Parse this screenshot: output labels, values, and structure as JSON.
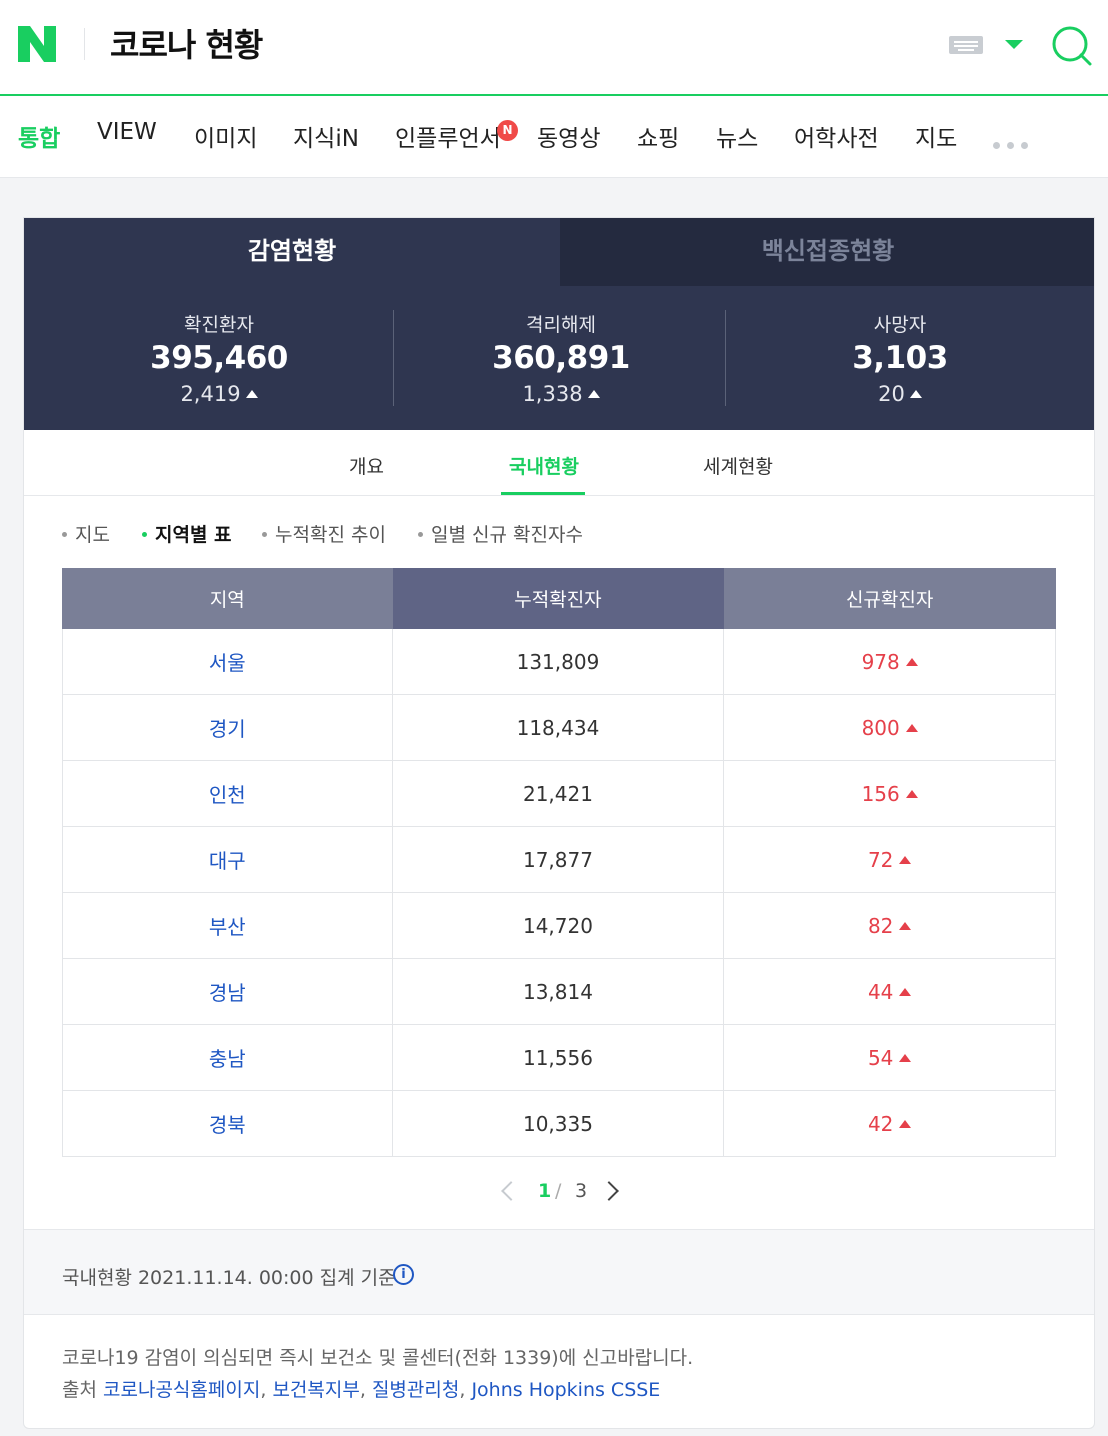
{
  "header": {
    "query": "코로나 현황"
  },
  "tabs": [
    "통합",
    "VIEW",
    "이미지",
    "지식iN",
    "인플루언서",
    "동영상",
    "쇼핑",
    "뉴스",
    "어학사전",
    "지도"
  ],
  "influencer_badge": "N",
  "card_tabs": [
    "감염현황",
    "백신접종현황"
  ],
  "stats": [
    {
      "label": "확진환자",
      "value": "395,460",
      "change": "2,419"
    },
    {
      "label": "격리해제",
      "value": "360,891",
      "change": "1,338"
    },
    {
      "label": "사망자",
      "value": "3,103",
      "change": "20"
    }
  ],
  "subtabs": [
    "개요",
    "국내현황",
    "세계현황"
  ],
  "filters": [
    "지도",
    "지역별 표",
    "누적확진 추이",
    "일별 신규 확진자수"
  ],
  "table": {
    "headers": [
      "지역",
      "누적확진자",
      "신규확진자"
    ],
    "rows": [
      {
        "region": "서울",
        "total": "131,809",
        "new": "978"
      },
      {
        "region": "경기",
        "total": "118,434",
        "new": "800"
      },
      {
        "region": "인천",
        "total": "21,421",
        "new": "156"
      },
      {
        "region": "대구",
        "total": "17,877",
        "new": "72"
      },
      {
        "region": "부산",
        "total": "14,720",
        "new": "82"
      },
      {
        "region": "경남",
        "total": "13,814",
        "new": "44"
      },
      {
        "region": "충남",
        "total": "11,556",
        "new": "54"
      },
      {
        "region": "경북",
        "total": "10,335",
        "new": "42"
      }
    ]
  },
  "pager": {
    "current": "1",
    "sep": "/",
    "total": "3"
  },
  "footer": {
    "basis": "국내현황 2021.11.14. 00:00 집계 기준",
    "notice": "코로나19 감염이 의심되면 즉시 보건소 및 콜센터(전화 1339)에 신고바랍니다.",
    "source_label": "출처",
    "sources": [
      "코로나공식홈페이지",
      "보건복지부",
      "질병관리청",
      "Johns Hopkins CSSE"
    ]
  },
  "colors": {
    "brand": "#19ce60",
    "panel": "#2f3650",
    "increase": "#e5404a",
    "link": "#1f57c3"
  }
}
